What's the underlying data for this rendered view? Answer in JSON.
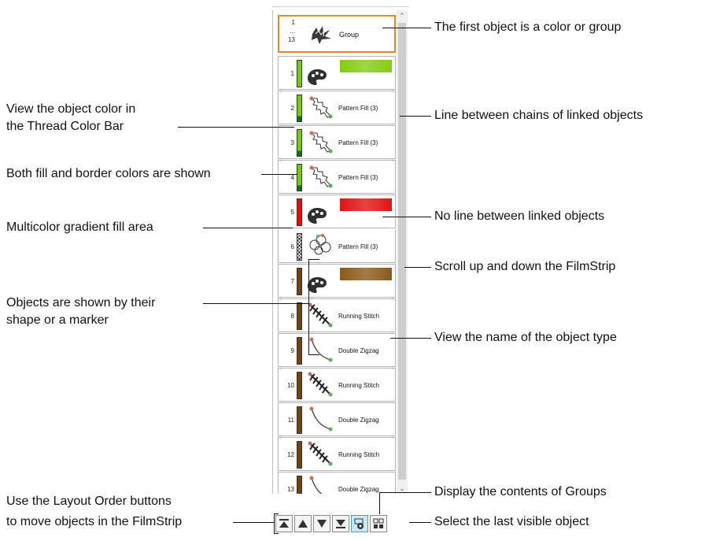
{
  "callouts": {
    "first_object": "The first object is a color or group",
    "view_color_1": "View the object color in",
    "view_color_2": "the Thread Color Bar",
    "line_between_chains": "Line between chains of linked objects",
    "fill_border": "Both fill and border colors are shown",
    "no_line": "No line between linked objects",
    "multicolor": "Multicolor gradient fill area",
    "scroll": "Scroll up and down the FilmStrip",
    "shape_marker_1": "Objects are shown by their",
    "shape_marker_2": "shape or a marker",
    "object_type": "View the name of the object type",
    "layout_order_1": "Use the Layout Order buttons",
    "layout_order_2": "to move objects in the FilmStrip",
    "groups": "Display the contents of Groups",
    "last_visible": "Select the last visible object"
  },
  "filmstrip": {
    "group_row": {
      "num_top": "1",
      "num_mid": "...",
      "num_bottom": "13",
      "label": "Group",
      "icon": "holly-group-icon"
    },
    "rows": [
      {
        "num": "1",
        "label": "",
        "color": "#7ac41e",
        "swatch": "#84cc14",
        "icon": "palette-icon"
      },
      {
        "num": "2",
        "label": "Pattern Fill (3)",
        "color": "#7ac41e",
        "border_color": "#1a6b22",
        "icon": "holly-leaf-icon"
      },
      {
        "num": "3",
        "label": "Pattern Fill (3)",
        "color": "#7ac41e",
        "border_color": "#1a6b22",
        "icon": "holly-leaf-icon"
      },
      {
        "num": "4",
        "label": "Pattern Fill (3)",
        "color": "#7ac41e",
        "border_color": "#1a6b22",
        "icon": "holly-leaf-icon"
      },
      {
        "num": "5",
        "label": "",
        "color": "#e01010",
        "swatch": "#e01414",
        "icon": "palette-icon"
      },
      {
        "num": "6",
        "label": "Pattern Fill (3)",
        "color": "multicolor",
        "icon": "berries-icon"
      },
      {
        "num": "7",
        "label": "",
        "color": "#6b4418",
        "swatch": "#8b5a1a",
        "icon": "palette-icon"
      },
      {
        "num": "8",
        "label": "Running Stitch",
        "color": "#6b4418",
        "icon": "pine-sprig-icon"
      },
      {
        "num": "9",
        "label": "Double Zigzag",
        "color": "#6b4418",
        "icon": "curve-stem-icon"
      },
      {
        "num": "10",
        "label": "Running Stitch",
        "color": "#6b4418",
        "icon": "pine-sprig-icon"
      },
      {
        "num": "11",
        "label": "Double Zigzag",
        "color": "#6b4418",
        "icon": "curve-stem-icon"
      },
      {
        "num": "12",
        "label": "Running Stitch",
        "color": "#6b4418",
        "icon": "pine-sprig-icon"
      },
      {
        "num": "13",
        "label": "Double Zigzag",
        "color": "#6b4418",
        "icon": "curve-stem-icon"
      }
    ]
  },
  "buttons": [
    {
      "name": "move-to-start-button",
      "icon": "move-to-start-icon"
    },
    {
      "name": "move-up-button",
      "icon": "move-up-icon"
    },
    {
      "name": "move-down-button",
      "icon": "move-down-icon"
    },
    {
      "name": "move-to-end-button",
      "icon": "move-to-end-icon"
    },
    {
      "name": "display-groups-button",
      "icon": "group-view-icon"
    },
    {
      "name": "select-last-visible-button",
      "icon": "select-last-icon"
    }
  ]
}
